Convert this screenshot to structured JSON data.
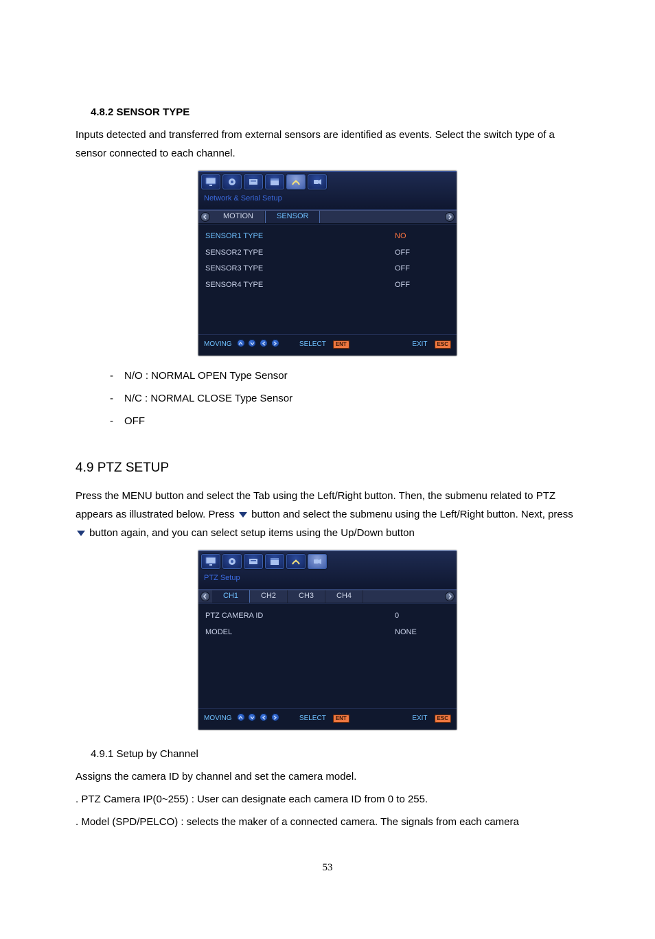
{
  "sec1": {
    "num_title": "4.8.2 SENSOR TYPE",
    "intro": "Inputs detected and transferred from external sensors are identified as events. Select the switch type of a sensor connected to each channel.",
    "osd": {
      "subtitle": "Network & Serial Setup",
      "tabs": [
        "MOTION",
        "SENSOR"
      ],
      "sel_tab_index": 1,
      "rows": [
        {
          "label": "SENSOR1 TYPE",
          "value": "NO",
          "selected": true
        },
        {
          "label": "SENSOR2 TYPE",
          "value": "OFF",
          "selected": false
        },
        {
          "label": "SENSOR3 TYPE",
          "value": "OFF",
          "selected": false
        },
        {
          "label": "SENSOR4 TYPE",
          "value": "OFF",
          "selected": false
        }
      ],
      "foot": {
        "moving": "MOVING",
        "select": "SELECT",
        "exit": "EXIT",
        "keys": {
          "ent": "ENT",
          "esc": "ESC"
        }
      }
    },
    "bullets": [
      "N/O : NORMAL OPEN Type Sensor",
      "N/C : NORMAL CLOSE Type Sensor",
      "OFF"
    ]
  },
  "sec2": {
    "heading": "4.9 PTZ SETUP",
    "p1a": "Press the MENU button and select the Tab using the Left/Right button. Then, the submenu related to PTZ appears as illustrated below. Press",
    "p1b": "button and select the submenu using the Left/Right button. Next, press",
    "p1c": "button again, and you can select setup items using the Up/Down button",
    "osd": {
      "subtitle": "PTZ Setup",
      "tabs": [
        "CH1",
        "CH2",
        "CH3",
        "CH4"
      ],
      "sel_tab_index": 0,
      "rows": [
        {
          "label": "PTZ CAMERA ID",
          "value": "0",
          "selected": false
        },
        {
          "label": "MODEL",
          "value": "NONE",
          "selected": false
        }
      ],
      "foot": {
        "moving": "MOVING",
        "select": "SELECT",
        "exit": "EXIT",
        "keys": {
          "ent": "ENT",
          "esc": "ESC"
        }
      }
    }
  },
  "sec3": {
    "num_title": "4.9.1 Setup by Channel",
    "p1": "Assigns the camera ID by channel and set the camera model.",
    "p2": ". PTZ Camera IP(0~255) : User can designate each camera ID from 0 to 255.",
    "p3": ". Model (SPD/PELCO) : selects the maker of a connected camera. The signals from each camera"
  },
  "page_number": "53",
  "osd_icons": [
    "display-icon",
    "record-icon",
    "event-icon",
    "schedule-icon",
    "network-icon",
    "ptz-icon"
  ]
}
